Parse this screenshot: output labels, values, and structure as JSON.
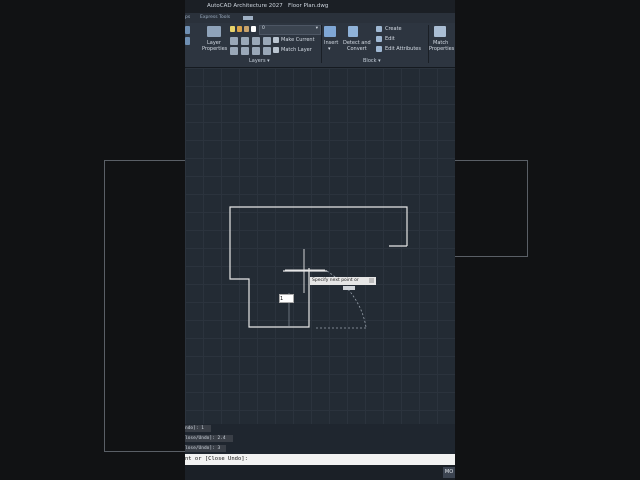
{
  "app": {
    "title": "AutoCAD Architecture 2027",
    "file": "Floor Plan.dwg"
  },
  "tabs": [
    "ps",
    "Express Tools"
  ],
  "ribbon": {
    "layers": {
      "layer_properties_label_1": "Layer",
      "layer_properties_label_2": "Properties",
      "make_current": "Make Current",
      "match_layer": "Match Layer",
      "layer_value": "0",
      "panel_label": "Layers ▾"
    },
    "block": {
      "insert": "Insert",
      "detect_convert_1": "Detect and",
      "detect_convert_2": "Convert",
      "create": "Create",
      "edit": "Edit",
      "edit_attributes": "Edit Attributes",
      "panel_label": "Block ▾"
    },
    "properties": {
      "match_label_1": "Match",
      "match_label_2": "Properties"
    }
  },
  "drawing": {
    "tooltip": "Specify next point or",
    "dynamic_input_value": "1"
  },
  "command_history": [
    "ndo]: 1",
    "lose/Undo]: 2.4",
    "lose/Undo]: 3"
  ],
  "command_line": "nt or [Close Undo]:",
  "status": {
    "model_label": "MO"
  },
  "colors": {
    "canvas": "#232b34",
    "ribbon": "#2d3540",
    "linework": "#e6e6e6"
  }
}
